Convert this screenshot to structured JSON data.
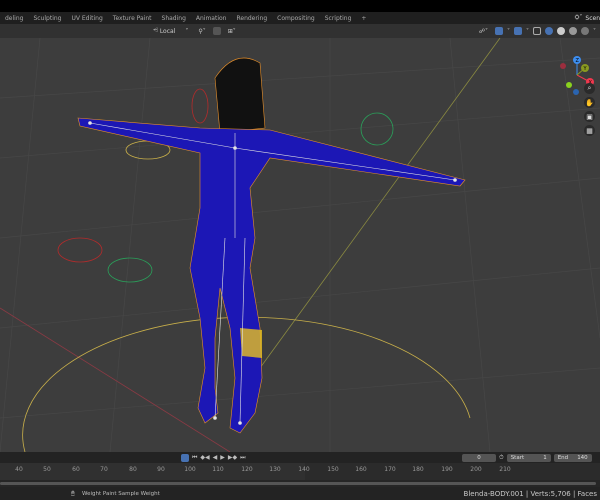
{
  "workspace_tabs": [
    "deling",
    "Sculpting",
    "UV Editing",
    "Texture Paint",
    "Shading",
    "Animation",
    "Rendering",
    "Compositing",
    "Scripting"
  ],
  "add_tab": "+",
  "scene_label": "Scen",
  "header": {
    "transform_pivot": "Local"
  },
  "timeline": {
    "current_frame": "0",
    "start_label": "Start",
    "start": "1",
    "end_label": "End",
    "end": "140",
    "ticks": [
      "40",
      "50",
      "60",
      "70",
      "80",
      "90",
      "100",
      "110",
      "120",
      "130",
      "140",
      "150",
      "160",
      "170",
      "180",
      "190",
      "200",
      "210"
    ]
  },
  "status": {
    "hint": "Weight Paint Sample Weight",
    "stats": "Blenda-BODY.001 | Verts:5,706 | Faces"
  },
  "gizmo": {
    "z": "Z",
    "y": "Y",
    "x": "X"
  },
  "colors": {
    "accent": "#4772b3",
    "mesh": "#1a1ab8",
    "wire": "#e8902a"
  }
}
